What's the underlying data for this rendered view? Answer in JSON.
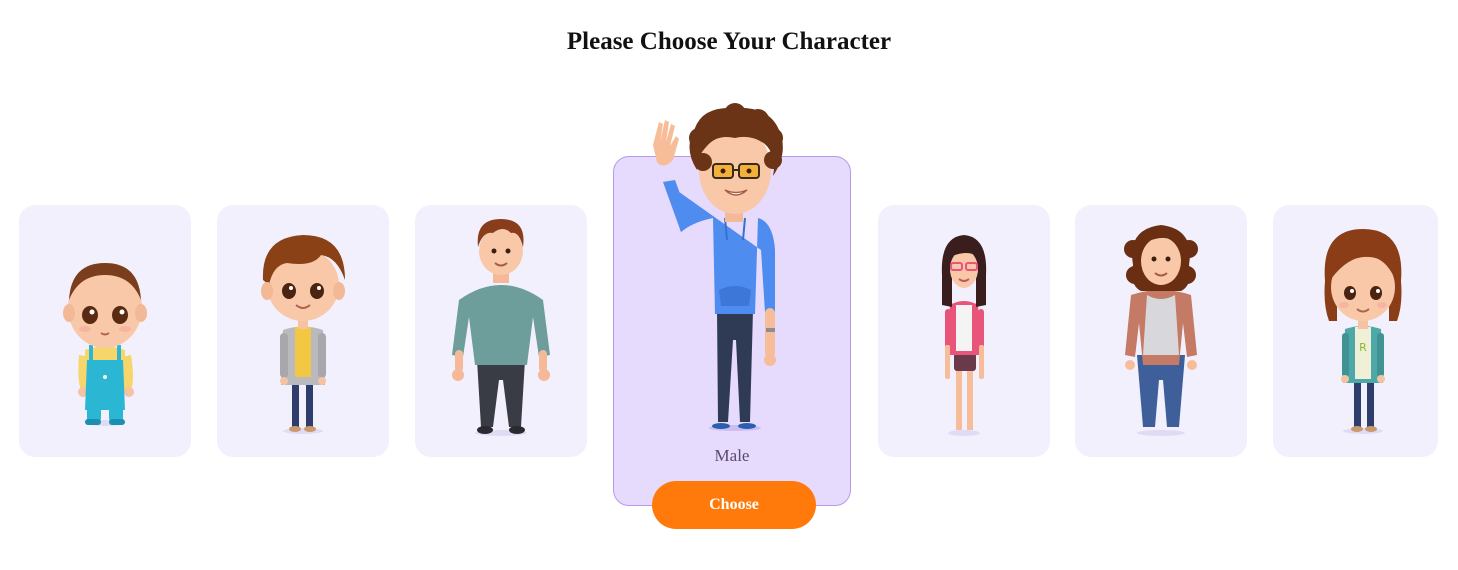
{
  "page": {
    "title": "Please Choose Your Character"
  },
  "characters": [
    {
      "id": "baby",
      "icon": "baby-character-icon"
    },
    {
      "id": "boy",
      "icon": "boy-character-icon"
    },
    {
      "id": "man",
      "icon": "man-character-icon"
    },
    {
      "id": "male",
      "icon": "male-character-icon",
      "label": "Male",
      "selected": true
    },
    {
      "id": "girl",
      "icon": "girl-character-icon"
    },
    {
      "id": "woman",
      "icon": "woman-character-icon"
    },
    {
      "id": "young-girl",
      "icon": "young-girl-character-icon"
    }
  ],
  "selected": {
    "label": "Male",
    "button_label": "Choose"
  },
  "colors": {
    "card_bg": "#f3f0fe",
    "selected_bg": "#e6dafd",
    "selected_border": "#b59be9",
    "button": "#ff7a0a"
  }
}
